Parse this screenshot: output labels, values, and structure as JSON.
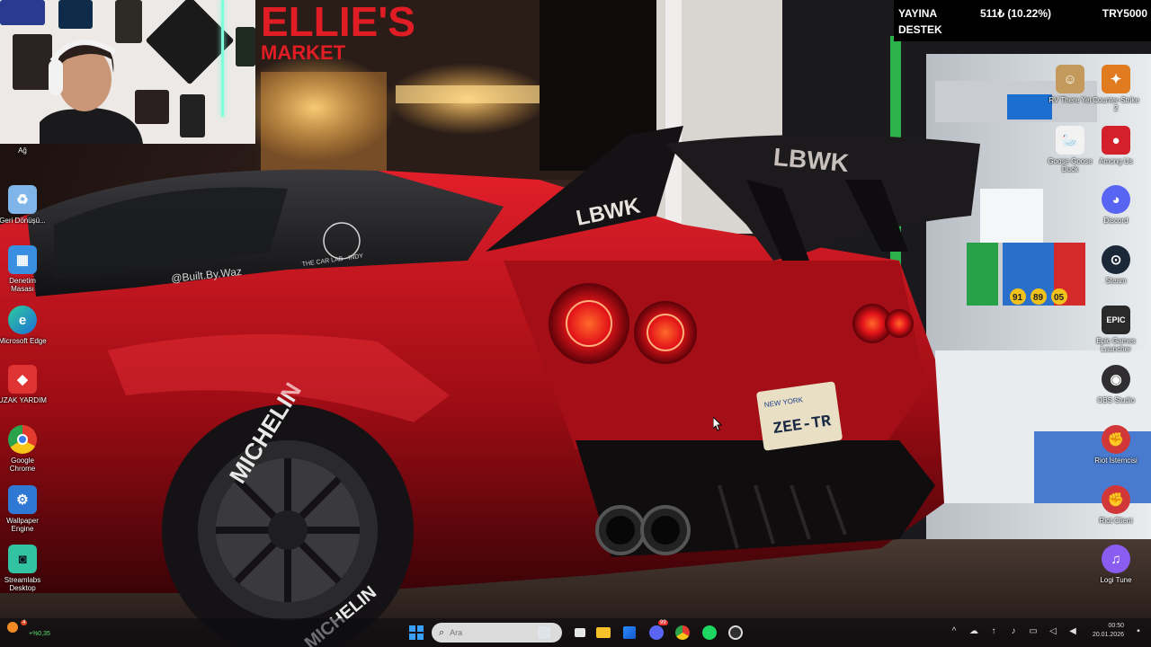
{
  "donation": {
    "line1": "YAYINA",
    "line2": "DESTEK",
    "amount": "511₺ (10.22%)",
    "goal": "TRY5000"
  },
  "left_icons": [
    {
      "label": "Ağ",
      "icon": "network-icon",
      "color": "#2b6fd6"
    },
    {
      "label": "Geri Dönüşü...",
      "icon": "recycle-bin-icon",
      "color": "#7fb5e8"
    },
    {
      "label": "Denetim Masası",
      "icon": "control-panel-icon",
      "color": "#3a8fe0"
    },
    {
      "label": "Microsoft Edge",
      "icon": "edge-icon",
      "color": "#1d9f8f"
    },
    {
      "label": "UZAK YARDIM",
      "icon": "remote-help-icon",
      "color": "#e03434"
    },
    {
      "label": "Google Chrome",
      "icon": "chrome-icon",
      "color": "#e8b32b"
    },
    {
      "label": "Wallpaper Engine",
      "icon": "wallpaper-engine-icon",
      "color": "#2f78d4"
    },
    {
      "label": "Streamlabs Desktop",
      "icon": "streamlabs-icon",
      "color": "#31c3a2"
    }
  ],
  "right_icons": [
    {
      "label": "RV There Yet",
      "icon": "rv-there-yet-icon",
      "color": "#c49a5c"
    },
    {
      "label": "Counter-Strike 2",
      "icon": "counter-strike-icon",
      "color": "#e07b1f"
    },
    {
      "label": "Goose Goose Duck",
      "icon": "goose-goose-duck-icon",
      "color": "#f2f2f2"
    },
    {
      "label": "Among Us",
      "icon": "among-us-icon",
      "color": "#d3202a"
    },
    {
      "label": "Discord",
      "icon": "discord-icon",
      "color": "#5865f2"
    },
    {
      "label": "Steam",
      "icon": "steam-icon",
      "color": "#1b2838"
    },
    {
      "label": "Epic Games Launcher",
      "icon": "epic-games-icon",
      "color": "#2a2a2a"
    },
    {
      "label": "OBS Studio",
      "icon": "obs-icon",
      "color": "#302e31"
    },
    {
      "label": "Riot İstemcisi",
      "icon": "riot-client-icon",
      "color": "#d13639"
    },
    {
      "label": "Riot Client",
      "icon": "riot-client-icon",
      "color": "#d13639"
    },
    {
      "label": "Logi Tune",
      "icon": "logi-tune-icon",
      "color": "#8a5cf0"
    }
  ],
  "taskbar": {
    "search_placeholder": "Ara",
    "weather_badge": "4",
    "weather_text": "+%0,35",
    "mail_badge": "99",
    "time": "00:50",
    "date": "20.01.2026"
  },
  "wallpaper": {
    "plate_top": "NEW YORK",
    "plate_text": "ZEE-TR",
    "wing_text": "LBWK",
    "spoiler_text": "LBWK",
    "side_text": "@Built.By.Waz",
    "lab_text": "THE CAR LAB - INDY",
    "tire_text": "MICHELIN",
    "tire_text_rear": "MICHELIN",
    "store_text": "ELLIE'S",
    "store_text2": "MARKET",
    "gas_prices": [
      "91",
      "89",
      "05"
    ]
  }
}
